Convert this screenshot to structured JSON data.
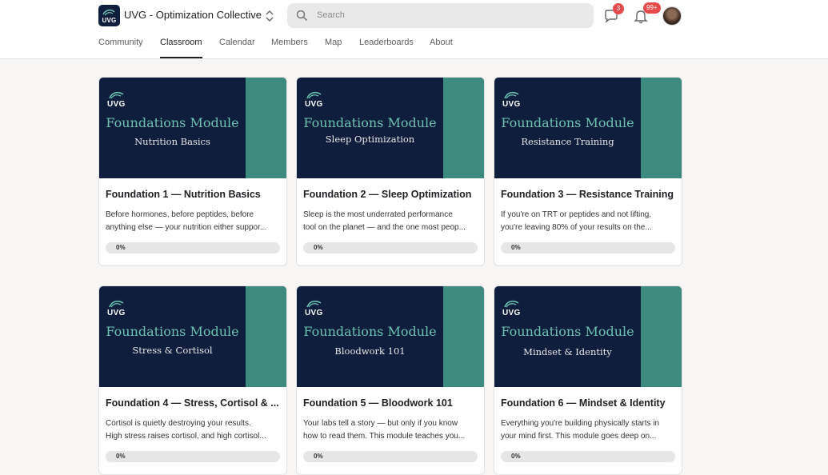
{
  "header": {
    "logo_text": "UVG",
    "app_title": "UVG - Optimization Collective",
    "search_placeholder": "Search",
    "chat_badge": "3",
    "notifications_badge": "99+"
  },
  "nav": {
    "tabs": [
      {
        "label": "Community"
      },
      {
        "label": "Classroom"
      },
      {
        "label": "Calendar"
      },
      {
        "label": "Members"
      },
      {
        "label": "Map"
      },
      {
        "label": "Leaderboards"
      },
      {
        "label": "About"
      }
    ],
    "active": "Classroom"
  },
  "colors": {
    "navy": "#0f1e3d",
    "teal": "#3d8a7f",
    "accent_text": "#6cc2b0",
    "badge": "#e54b4b"
  },
  "courses": [
    {
      "thumb_logo": "UVG",
      "thumb_heading": "Foundations Module",
      "thumb_subtitle": "Nutrition Basics",
      "title": "Foundation 1 — Nutrition Basics",
      "desc_line1": "Before hormones, before peptides, before",
      "desc_line2": "anything else — your nutrition either suppor...",
      "progress_label": "0%",
      "progress": 0
    },
    {
      "thumb_logo": "UVG",
      "thumb_heading": "Foundations Module",
      "thumb_subtitle": "Sleep Optimization",
      "title": "Foundation 2 — Sleep Optimization",
      "desc_line1": "Sleep is the most underrated performance",
      "desc_line2": "tool on the planet — and the one most peop...",
      "progress_label": "0%",
      "progress": 0
    },
    {
      "thumb_logo": "UVG",
      "thumb_heading": "Foundations Module",
      "thumb_subtitle": "Resistance Training",
      "title": "Foundation 3 — Resistance Training",
      "desc_line1": "If you're on TRT or peptides and not lifting,",
      "desc_line2": "you're leaving 80% of your results on the...",
      "progress_label": "0%",
      "progress": 0
    },
    {
      "thumb_logo": "UVG",
      "thumb_heading": "Foundations Module",
      "thumb_subtitle": "Stress & Cortisol",
      "title": "Foundation 4 — Stress, Cortisol & ...",
      "desc_line1": "Cortisol is quietly destroying your results.",
      "desc_line2": "High stress raises cortisol, and high cortisol...",
      "progress_label": "0%",
      "progress": 0
    },
    {
      "thumb_logo": "UVG",
      "thumb_heading": "Foundations Module",
      "thumb_subtitle": "Bloodwork 101",
      "title": "Foundation 5 — Bloodwork 101",
      "desc_line1": "Your labs tell a story — but only if you know",
      "desc_line2": "how to read them. This module teaches you...",
      "progress_label": "0%",
      "progress": 0
    },
    {
      "thumb_logo": "UVG",
      "thumb_heading": "Foundations Module",
      "thumb_subtitle": "Mindset & Identity",
      "title": "Foundation 6 — Mindset & Identity",
      "desc_line1": "Everything you're building physically starts in",
      "desc_line2": "your mind first. This module goes deep on...",
      "progress_label": "0%",
      "progress": 0
    }
  ]
}
